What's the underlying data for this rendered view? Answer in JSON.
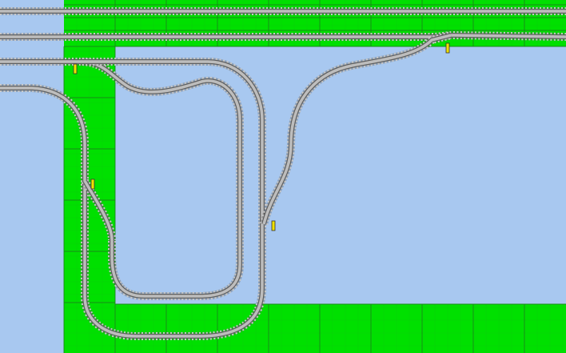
{
  "editor": {
    "background_color": "#a8c8f0",
    "baseplate_color": "#00e000",
    "baseplate_grid_color": "#1a8a1a",
    "rail_color": "#606060",
    "sleeper_color": "#c8c8c8",
    "switch_lever_color": "#f0e000",
    "tracks": [
      {
        "kind": "straight-track",
        "row": 1
      },
      {
        "kind": "straight-track",
        "row": 2
      },
      {
        "kind": "straight-track",
        "row": 3
      },
      {
        "kind": "straight-track",
        "row": 4
      },
      {
        "kind": "oval-loop",
        "row": 5
      },
      {
        "kind": "crossover-curve",
        "row": 6
      }
    ],
    "switches": [
      {
        "kind": "switch-point",
        "id": 1
      },
      {
        "kind": "switch-point",
        "id": 2
      },
      {
        "kind": "switch-point",
        "id": 3
      },
      {
        "kind": "switch-point",
        "id": 4
      }
    ]
  }
}
